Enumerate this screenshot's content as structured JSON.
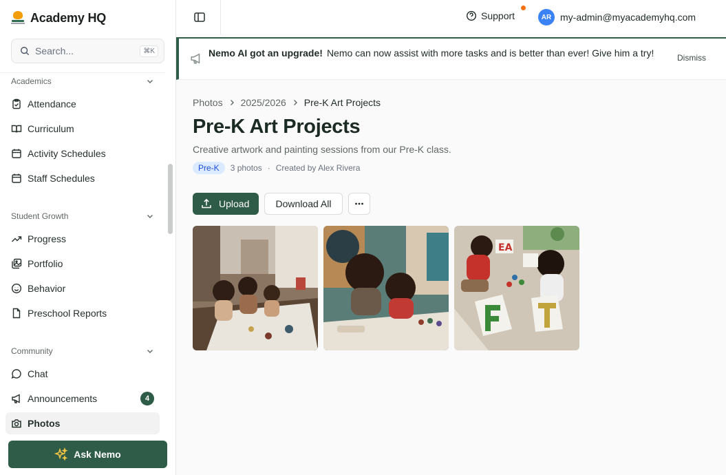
{
  "app": {
    "name": "Academy HQ"
  },
  "search": {
    "placeholder": "Search...",
    "shortcut": "⌘K"
  },
  "sidebar": {
    "sections": [
      {
        "title": "Academics",
        "items": [
          {
            "label": "Attendance",
            "icon": "clipboard-check-icon"
          },
          {
            "label": "Curriculum",
            "icon": "book-open-icon"
          },
          {
            "label": "Activity Schedules",
            "icon": "calendar-icon"
          },
          {
            "label": "Staff Schedules",
            "icon": "calendar-icon"
          }
        ]
      },
      {
        "title": "Student Growth",
        "items": [
          {
            "label": "Progress",
            "icon": "trending-up-icon"
          },
          {
            "label": "Portfolio",
            "icon": "images-icon"
          },
          {
            "label": "Behavior",
            "icon": "smile-icon"
          },
          {
            "label": "Preschool Reports",
            "icon": "file-icon"
          }
        ]
      },
      {
        "title": "Community",
        "items": [
          {
            "label": "Chat",
            "icon": "chat-bubble-icon"
          },
          {
            "label": "Announcements",
            "icon": "megaphone-icon",
            "badge": "4"
          },
          {
            "label": "Photos",
            "icon": "camera-icon",
            "active": true
          }
        ]
      }
    ],
    "ask_nemo": "Ask Nemo"
  },
  "topbar": {
    "support": "Support",
    "avatar_initials": "AR",
    "user_email": "my-admin@myacademyhq.com"
  },
  "banner": {
    "title": "Nemo AI got an upgrade!",
    "message": "Nemo can now assist with more tasks and is better than ever! Give him a try!",
    "dismiss": "Dismiss"
  },
  "breadcrumb": [
    "Photos",
    "2025/2026",
    "Pre-K Art Projects"
  ],
  "album": {
    "title": "Pre-K Art Projects",
    "description": "Creative artwork and painting sessions from our Pre-K class.",
    "tag": "Pre-K",
    "photo_count": "3 photos",
    "separator": "·",
    "created_by": "Created by Alex Rivera"
  },
  "actions": {
    "upload": "Upload",
    "download_all": "Download All",
    "more": "···"
  },
  "photos": [
    {
      "name": "photo-art-table"
    },
    {
      "name": "photo-painting-girls"
    },
    {
      "name": "photo-floor-painting"
    }
  ],
  "colors": {
    "brand": "#2f5c48",
    "accent": "#f97316",
    "tag_bg": "#dbeafe",
    "tag_fg": "#1d4ed8",
    "avatar": "#3b82f6"
  }
}
